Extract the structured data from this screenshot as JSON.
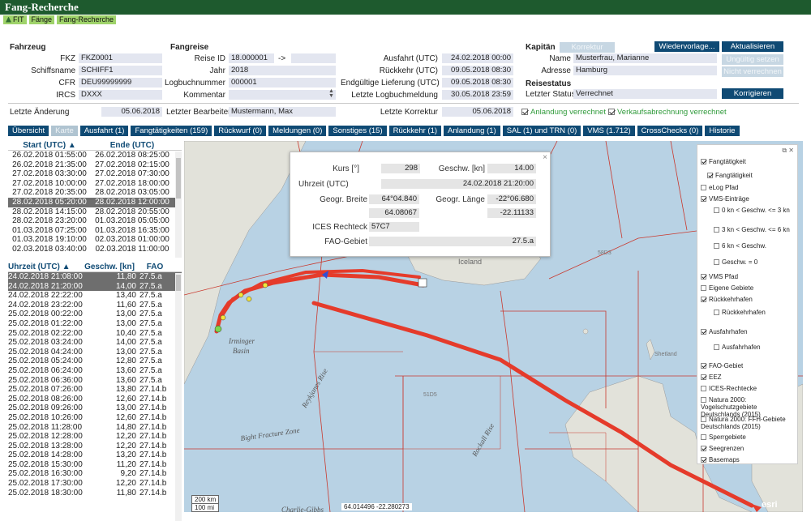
{
  "title": "Fang-Recherche",
  "breadcrumb": [
    "FIT",
    "Fänge",
    "Fang-Recherche"
  ],
  "fahrzeug": {
    "header": "Fahrzeug",
    "fkz_label": "FKZ",
    "fkz": "FKZ0001",
    "schiffsname_label": "Schiffsname",
    "schiffsname": "SCHIFF1",
    "cfr_label": "CFR",
    "cfr": "DEU99999999",
    "ircs_label": "IRCS",
    "ircs": "DXXX"
  },
  "fangreise": {
    "header": "Fangreise",
    "reise_id_label": "Reise ID",
    "reise_id": "18.000001",
    "reise_id_sep": "->",
    "jahr_label": "Jahr",
    "jahr": "2018",
    "logbuch_label": "Logbuchnummer",
    "logbuch": "000001",
    "kommentar_label": "Kommentar"
  },
  "zeiten": {
    "ausfahrt_label": "Ausfahrt (UTC)",
    "ausfahrt": "24.02.2018 00:00",
    "rueckkehr_label": "Rückkehr (UTC)",
    "rueckkehr": "09.05.2018 08:30",
    "endg_label": "Endgültige Lieferung (UTC)",
    "endg": "09.05.2018 08:30",
    "letzte_lb_label": "Letzte Logbuchmeldung",
    "letzte_lb": "30.05.2018 23:59"
  },
  "kapitaen": {
    "header": "Kapitän",
    "korrektur_btn": "Korrektur",
    "name_label": "Name",
    "name": "Musterfrau, Marianne",
    "adresse_label": "Adresse",
    "adresse": "Hamburg"
  },
  "reisestatus": {
    "header": "Reisestatus",
    "status_label": "Letzter Status",
    "status": "Verrechnet"
  },
  "buttons": {
    "wiedervorlage": "Wiedervorlage...",
    "aktualisieren": "Aktualisieren",
    "ungueltig": "Ungültig setzen",
    "nicht_verrechnen": "Nicht verrechnen",
    "korrigieren": "Korrigieren"
  },
  "meta": {
    "letzte_aenderung_label": "Letzte Änderung",
    "letzte_aenderung": "05.06.2018",
    "letzter_bearbeiter_label": "Letzter Bearbeiter",
    "letzter_bearbeiter": "Mustermann, Max",
    "letzte_korrektur_label": "Letzte Korrektur",
    "letzte_korrektur": "05.06.2018",
    "anlandung": "Anlandung verrechnet",
    "verkauf": "Verkaufsabrechnung verrechnet"
  },
  "tabs": [
    "Übersicht",
    "Karte",
    "Ausfahrt (1)",
    "Fangtätigkeiten (159)",
    "Rückwurf (0)",
    "Meldungen (0)",
    "Sonstiges (15)",
    "Rückkehr (1)",
    "Anlandung (1)",
    "SAL (1) und TRN (0)",
    "VMS (1.712)",
    "CrossChecks (0)",
    "Historie"
  ],
  "activity_table": {
    "headers": [
      "Start (UTC) ▲",
      "Ende (UTC)"
    ],
    "rows": [
      [
        "26.02.2018 01:55:00",
        "26.02.2018 08:25:00"
      ],
      [
        "26.02.2018 21:35:00",
        "27.02.2018 02:15:00"
      ],
      [
        "27.02.2018 03:30:00",
        "27.02.2018 07:30:00"
      ],
      [
        "27.02.2018 10:00:00",
        "27.02.2018 18:00:00"
      ],
      [
        "27.02.2018 20:35:00",
        "28.02.2018 03:05:00"
      ],
      [
        "28.02.2018 05:20:00",
        "28.02.2018 12:00:00"
      ],
      [
        "28.02.2018 14:15:00",
        "28.02.2018 20:55:00"
      ],
      [
        "28.02.2018 23:20:00",
        "01.03.2018 05:05:00"
      ],
      [
        "01.03.2018 07:25:00",
        "01.03.2018 16:35:00"
      ],
      [
        "01.03.2018 19:10:00",
        "02.03.2018 01:00:00"
      ],
      [
        "02.03.2018 03:40:00",
        "02.03.2018 11:00:00"
      ]
    ],
    "selected_row": 5
  },
  "vms_table": {
    "headers": [
      "Uhrzeit (UTC) ▲",
      "Geschw. [kn]",
      "FAO"
    ],
    "rows": [
      [
        "24.02.2018 21:08:00",
        "11,80",
        "27.5.a"
      ],
      [
        "24.02.2018 21:20:00",
        "14,00",
        "27.5.a"
      ],
      [
        "24.02.2018 22:22:00",
        "13,40",
        "27.5.a"
      ],
      [
        "24.02.2018 23:22:00",
        "11,60",
        "27.5.a"
      ],
      [
        "25.02.2018 00:22:00",
        "13,00",
        "27.5.a"
      ],
      [
        "25.02.2018 01:22:00",
        "13,00",
        "27.5.a"
      ],
      [
        "25.02.2018 02:22:00",
        "10,40",
        "27.5.a"
      ],
      [
        "25.02.2018 03:24:00",
        "14,00",
        "27.5.a"
      ],
      [
        "25.02.2018 04:24:00",
        "13,00",
        "27.5.a"
      ],
      [
        "25.02.2018 05:24:00",
        "12,80",
        "27.5.a"
      ],
      [
        "25.02.2018 06:24:00",
        "13,60",
        "27.5.a"
      ],
      [
        "25.02.2018 06:36:00",
        "13,60",
        "27.5.a"
      ],
      [
        "25.02.2018 07:26:00",
        "13,80",
        "27.14.b"
      ],
      [
        "25.02.2018 08:26:00",
        "12,60",
        "27.14.b"
      ],
      [
        "25.02.2018 09:26:00",
        "13,00",
        "27.14.b"
      ],
      [
        "25.02.2018 10:26:00",
        "12,60",
        "27.14.b"
      ],
      [
        "25.02.2018 11:28:00",
        "14,80",
        "27.14.b"
      ],
      [
        "25.02.2018 12:28:00",
        "12,20",
        "27.14.b"
      ],
      [
        "25.02.2018 13:28:00",
        "12,20",
        "27.14.b"
      ],
      [
        "25.02.2018 14:28:00",
        "13,20",
        "27.14.b"
      ],
      [
        "25.02.2018 15:30:00",
        "11,20",
        "27.14.b"
      ],
      [
        "25.02.2018 16:30:00",
        "9,20",
        "27.14.b"
      ],
      [
        "25.02.2018 17:30:00",
        "12,20",
        "27.14.b"
      ],
      [
        "25.02.2018 18:30:00",
        "11,80",
        "27.14.b"
      ]
    ],
    "selected_rows": [
      0,
      1
    ]
  },
  "popup": {
    "kurs_label": "Kurs [°]",
    "kurs": "298",
    "geschw_label": "Geschw. [kn]",
    "geschw": "14.00",
    "uhrzeit_label": "Uhrzeit (UTC)",
    "uhrzeit": "24.02.2018 21:20:00",
    "breite_label": "Geogr. Breite",
    "breite_dms": "64°04.840",
    "breite_dec": "64.08067",
    "laenge_label": "Geogr. Länge",
    "laenge_dms": "-22°06.680",
    "laenge_dec": "-22.11133",
    "ices_label": "ICES Rechteck",
    "ices": "57C7",
    "fao_label": "FAO-Gebiet",
    "fao": "27.5.a"
  },
  "map_labels": {
    "iceland": "Iceland",
    "irminger": "Irminger",
    "basin": "Basin",
    "reykjanes": "Reykjanes Rise",
    "bight": "Bight Fracture Zone",
    "rockall": "Rockall Rise",
    "charlie": "Charlie-Gibbs",
    "shetland": "Shetland",
    "esri": "esri",
    "cell_1": "58D3",
    "cell_2": "51D5"
  },
  "scalebar": {
    "km": "200 km",
    "mi": "100 mi"
  },
  "coords_text": "64.014496   -22.280273",
  "layers": {
    "items": [
      "Fangtätigkeit",
      "Fangtätigkeit",
      "eLog Pfad",
      "VMS-Einträge",
      "0 kn < Geschw. <= 3 kn",
      "3 kn < Geschw. <= 6 kn",
      "6 kn < Geschw.",
      "Geschw. = 0",
      "VMS Pfad",
      "Eigene Gebiete",
      "Rückkehrhafen",
      "Rückkehrhafen",
      "Ausfahrhafen",
      "Ausfahrhafen",
      "FAO-Gebiet",
      "EEZ",
      "ICES-Rechtecke",
      "Natura 2000: Vogelschutzgebiete Deutschlands (2015)",
      "Natura 2000: FFH-Gebiete Deutschlands (2015)",
      "Sperrgebiete",
      "Seegrenzen",
      "Basemaps"
    ]
  },
  "colors": {
    "brand": "#1e5a2e",
    "accent": "#0f4a74",
    "track": "#e53b2b",
    "sea": "#b8d2e4",
    "land": "#e2e2da"
  }
}
